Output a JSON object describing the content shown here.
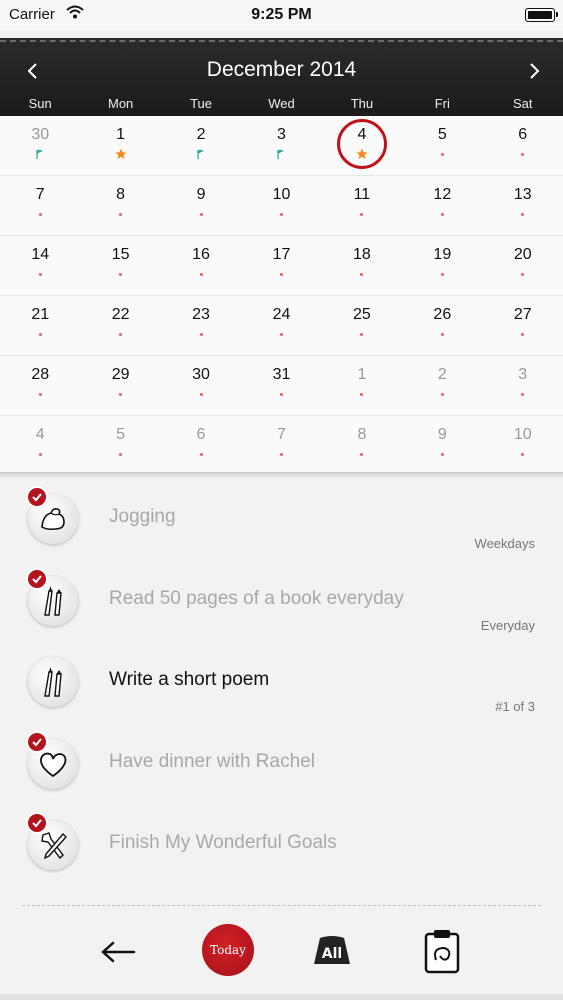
{
  "status_bar": {
    "carrier": "Carrier",
    "time": "9:25 PM"
  },
  "calendar": {
    "title": "December 2014",
    "weekdays": [
      "Sun",
      "Mon",
      "Tue",
      "Wed",
      "Thu",
      "Fri",
      "Sat"
    ],
    "weeks": [
      [
        {
          "d": "30",
          "dim": true,
          "mark": "flag"
        },
        {
          "d": "1",
          "mark": "star"
        },
        {
          "d": "2",
          "mark": "flag"
        },
        {
          "d": "3",
          "mark": "flag"
        },
        {
          "d": "4",
          "mark": "star",
          "today": true
        },
        {
          "d": "5",
          "mark": "dot"
        },
        {
          "d": "6",
          "mark": "dot"
        }
      ],
      [
        {
          "d": "7",
          "mark": "dot"
        },
        {
          "d": "8",
          "mark": "dot"
        },
        {
          "d": "9",
          "mark": "dot"
        },
        {
          "d": "10",
          "mark": "dot"
        },
        {
          "d": "11",
          "mark": "dot"
        },
        {
          "d": "12",
          "mark": "dot"
        },
        {
          "d": "13",
          "mark": "dot"
        }
      ],
      [
        {
          "d": "14",
          "mark": "dot"
        },
        {
          "d": "15",
          "mark": "dot"
        },
        {
          "d": "16",
          "mark": "dot"
        },
        {
          "d": "17",
          "mark": "dot"
        },
        {
          "d": "18",
          "mark": "dot"
        },
        {
          "d": "19",
          "mark": "dot"
        },
        {
          "d": "20",
          "mark": "dot"
        }
      ],
      [
        {
          "d": "21",
          "mark": "dot"
        },
        {
          "d": "22",
          "mark": "dot"
        },
        {
          "d": "23",
          "mark": "dot"
        },
        {
          "d": "24",
          "mark": "dot"
        },
        {
          "d": "25",
          "mark": "dot"
        },
        {
          "d": "26",
          "mark": "dot"
        },
        {
          "d": "27",
          "mark": "dot"
        }
      ],
      [
        {
          "d": "28",
          "mark": "dot"
        },
        {
          "d": "29",
          "mark": "dot"
        },
        {
          "d": "30",
          "mark": "dot"
        },
        {
          "d": "31",
          "mark": "dot"
        },
        {
          "d": "1",
          "dim": true,
          "mark": "dot"
        },
        {
          "d": "2",
          "dim": true,
          "mark": "dot"
        },
        {
          "d": "3",
          "dim": true,
          "mark": "dot"
        }
      ],
      [
        {
          "d": "4",
          "dim": true,
          "mark": "dot"
        },
        {
          "d": "5",
          "dim": true,
          "mark": "dot"
        },
        {
          "d": "6",
          "dim": true,
          "mark": "dot"
        },
        {
          "d": "7",
          "dim": true,
          "mark": "dot"
        },
        {
          "d": "8",
          "dim": true,
          "mark": "dot"
        },
        {
          "d": "9",
          "dim": true,
          "mark": "dot"
        },
        {
          "d": "10",
          "dim": true,
          "mark": "dot"
        }
      ]
    ]
  },
  "goals": [
    {
      "title": "Jogging",
      "freq": "Weekdays",
      "done": true,
      "icon": "muscle-arm-icon"
    },
    {
      "title": "Read 50 pages of a book everyday",
      "freq": "Everyday",
      "done": true,
      "icon": "pen-brush-icon"
    },
    {
      "title": "Write a short poem",
      "freq": "#1 of 3",
      "done": false,
      "icon": "pen-brush-icon"
    },
    {
      "title": "Have dinner with Rachel",
      "freq": "",
      "done": true,
      "icon": "heart-icon"
    },
    {
      "title": "Finish My Wonderful Goals",
      "freq": "",
      "done": true,
      "icon": "tools-icon"
    }
  ],
  "toolbar": {
    "today_label": "Today",
    "all_label": "All"
  },
  "colors": {
    "accent": "#b3141e",
    "dot": "#ef5b6d",
    "star": "#f28a1c",
    "flag": "#3aa7a4"
  }
}
